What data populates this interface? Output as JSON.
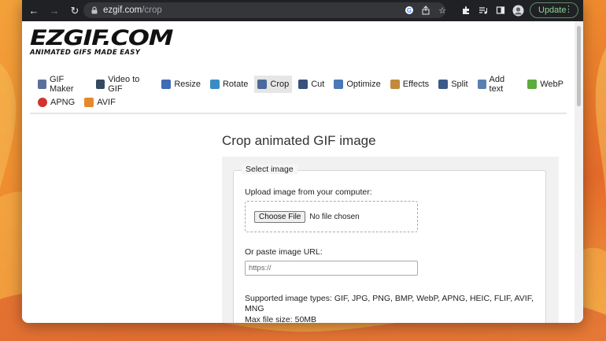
{
  "browser": {
    "url_host": "ezgif.com",
    "url_path": "/crop",
    "update_label": "Update",
    "icons": [
      "back-icon",
      "forward-icon",
      "reload-icon",
      "lock-icon",
      "google-icon",
      "share-icon",
      "star-icon",
      "extensions-icon",
      "media-icon",
      "sidepanel-icon",
      "profile-icon",
      "menu-icon"
    ]
  },
  "site": {
    "logo_text": "EZGIF.COM",
    "tagline": "ANIMATED GIFS MADE EASY"
  },
  "menu": {
    "row1": [
      {
        "label": "GIF Maker",
        "icon": "gif-maker-icon",
        "color": "#5a6f9e"
      },
      {
        "label": "Video to GIF",
        "icon": "film-icon",
        "color": "#33495f"
      },
      {
        "label": "Resize",
        "icon": "resize-icon",
        "color": "#3e6cb5"
      },
      {
        "label": "Rotate",
        "icon": "rotate-icon",
        "color": "#3a8dc4"
      },
      {
        "label": "Crop",
        "icon": "crop-icon",
        "color": "#4b6a9a",
        "active": true
      },
      {
        "label": "Cut",
        "icon": "cut-icon",
        "color": "#39507a"
      },
      {
        "label": "Optimize",
        "icon": "optimize-icon",
        "color": "#4a78b8"
      },
      {
        "label": "Effects",
        "icon": "effects-icon",
        "color": "#c28a3a"
      },
      {
        "label": "Split",
        "icon": "split-icon",
        "color": "#3a5a8a"
      },
      {
        "label": "Add text",
        "icon": "text-icon",
        "color": "#5a7fb0"
      },
      {
        "label": "WebP",
        "icon": "webp-icon",
        "color": "#5cab3c"
      }
    ],
    "row2": [
      {
        "label": "APNG",
        "icon": "apng-icon",
        "color": "#d0342c"
      },
      {
        "label": "AVIF",
        "icon": "avif-icon",
        "color": "#e58a2c"
      }
    ]
  },
  "main": {
    "title": "Crop animated GIF image",
    "legend": "Select image",
    "upload_label": "Upload image from your computer:",
    "choose_file": "Choose File",
    "no_file": "No file chosen",
    "url_label": "Or paste image URL:",
    "url_placeholder": "https://",
    "supported": "Supported image types: GIF, JPG, PNG, BMP, WebP, APNG, HEIC, FLIF, AVIF, MNG",
    "max_size": "Max file size: 50MB"
  }
}
